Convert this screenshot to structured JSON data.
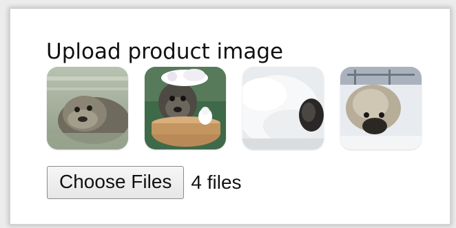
{
  "upload": {
    "title": "Upload product image",
    "choose_label": "Choose Files",
    "file_status": "4 files"
  },
  "thumbnails": [
    {
      "name": "seal-photo-1"
    },
    {
      "name": "seal-photo-2"
    },
    {
      "name": "seal-photo-3"
    },
    {
      "name": "seal-photo-4"
    }
  ],
  "colors": {
    "background": "#ececec",
    "panel": "#ffffff",
    "text": "#111111",
    "button_border": "#8a8a8a"
  }
}
